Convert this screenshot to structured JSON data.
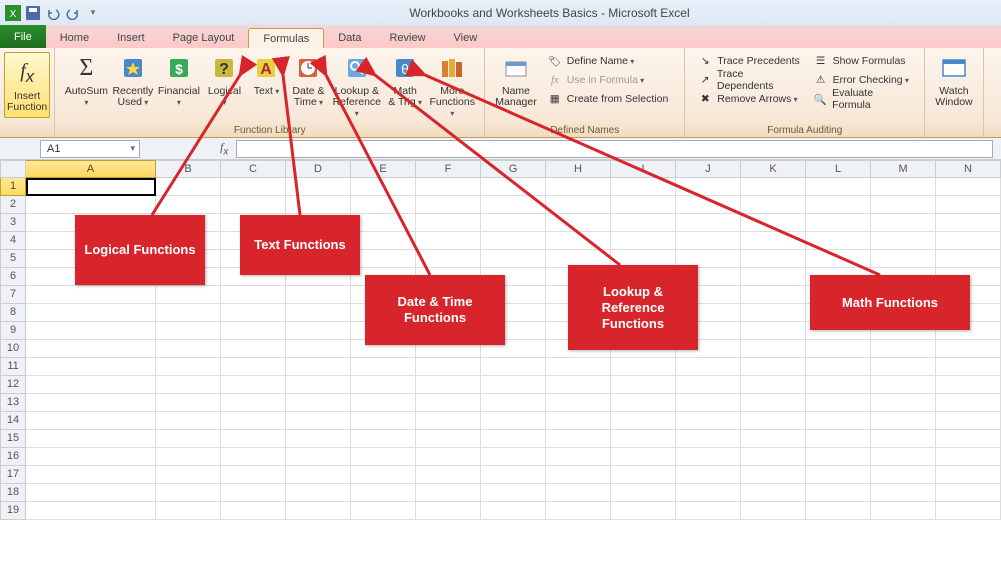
{
  "title": "Workbooks and Worksheets Basics - Microsoft Excel",
  "tabs": {
    "file": "File",
    "items": [
      "Home",
      "Insert",
      "Page Layout",
      "Formulas",
      "Data",
      "Review",
      "View"
    ],
    "active": "Formulas"
  },
  "ribbon": {
    "insert_function": "Insert\nFunction",
    "lib": {
      "autosum": "AutoSum",
      "recently": "Recently\nUsed",
      "financial": "Financial",
      "logical": "Logical",
      "text": "Text",
      "datetime": "Date &\nTime",
      "lookup": "Lookup &\nReference",
      "math": "Math\n& Trig",
      "more": "More\nFunctions",
      "group_label": "Function Library"
    },
    "names": {
      "manager": "Name\nManager",
      "define": "Define Name",
      "use": "Use in Formula",
      "create": "Create from Selection",
      "group_label": "Defined Names"
    },
    "audit": {
      "precedents": "Trace Precedents",
      "dependents": "Trace Dependents",
      "remove": "Remove Arrows",
      "show": "Show Formulas",
      "error": "Error Checking",
      "evaluate": "Evaluate Formula",
      "group_label": "Formula Auditing"
    },
    "watch": "Watch\nWindow"
  },
  "namebox": "A1",
  "columns": [
    "A",
    "B",
    "C",
    "D",
    "E",
    "F",
    "G",
    "H",
    "I",
    "J",
    "K",
    "L",
    "M",
    "N"
  ],
  "rows_count": 19,
  "active_cell": "A1",
  "callouts": {
    "logical": "Logical Functions",
    "text": "Text Functions",
    "datetime": "Date & Time Functions",
    "lookup": "Lookup & Reference Functions",
    "math": "Math Functions"
  }
}
